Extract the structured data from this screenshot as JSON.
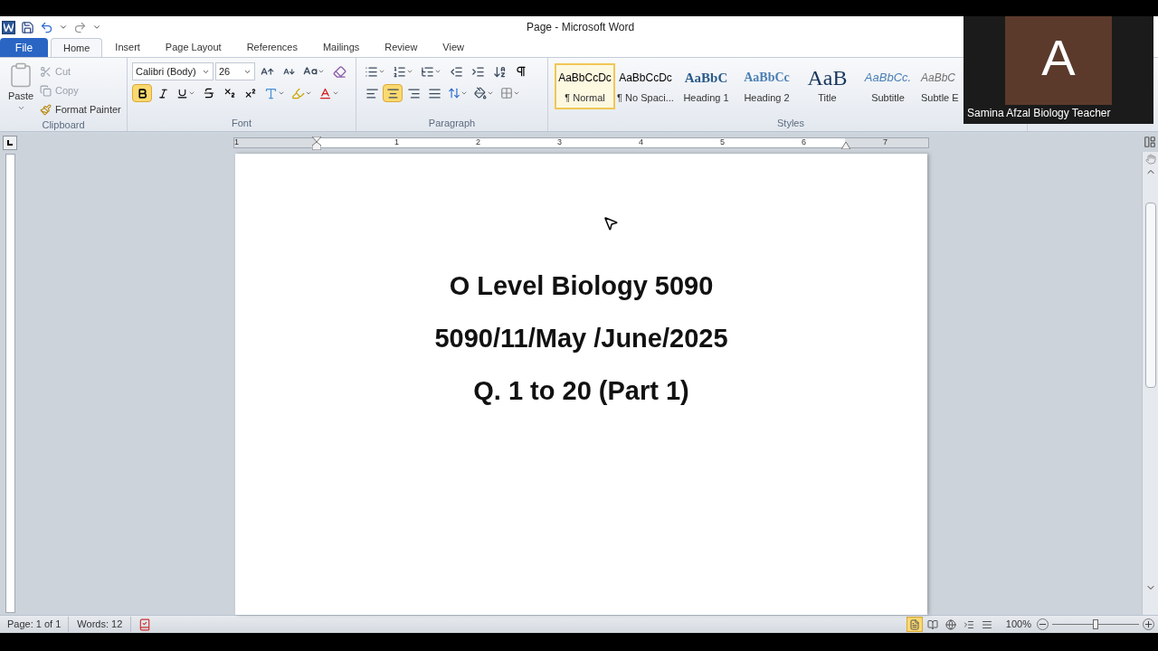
{
  "title_bar": {
    "title": "Page - Microsoft Word"
  },
  "tabs": [
    {
      "label": "File",
      "selected": false,
      "kind": "file"
    },
    {
      "label": "Home",
      "selected": true,
      "kind": "tab"
    },
    {
      "label": "Insert",
      "selected": false,
      "kind": "tab"
    },
    {
      "label": "Page Layout",
      "selected": false,
      "kind": "tab"
    },
    {
      "label": "References",
      "selected": false,
      "kind": "tab"
    },
    {
      "label": "Mailings",
      "selected": false,
      "kind": "tab"
    },
    {
      "label": "Review",
      "selected": false,
      "kind": "tab"
    },
    {
      "label": "View",
      "selected": false,
      "kind": "tab"
    }
  ],
  "clipboard": {
    "paste": "Paste",
    "cut": "Cut",
    "copy": "Copy",
    "format_painter": "Format Painter",
    "group": "Clipboard"
  },
  "font": {
    "name": "Calibri (Body)",
    "size": "26",
    "bold": true,
    "italic": false,
    "underline": false,
    "group": "Font"
  },
  "paragraph": {
    "show_marks": false,
    "group": "Paragraph",
    "alignments": [
      {
        "kind": "left",
        "selected": false
      },
      {
        "kind": "center",
        "selected": true
      },
      {
        "kind": "right",
        "selected": false
      },
      {
        "kind": "justify",
        "selected": false
      }
    ]
  },
  "styles": {
    "group": "Styles",
    "items": [
      {
        "preview": "AaBbCcDc",
        "label": "¶ Normal",
        "selected": true,
        "kind": "normal"
      },
      {
        "preview": "AaBbCcDc",
        "label": "¶ No Spaci...",
        "selected": false,
        "kind": "normal"
      },
      {
        "preview": "AaBbC",
        "label": "Heading 1",
        "selected": false,
        "kind": "heading1"
      },
      {
        "preview": "AaBbCc",
        "label": "Heading 2",
        "selected": false,
        "kind": "heading2"
      },
      {
        "preview": "AaB",
        "label": "Title",
        "selected": false,
        "kind": "title"
      },
      {
        "preview": "AaBbCc.",
        "label": "Subtitle",
        "selected": false,
        "kind": "subtitle"
      },
      {
        "preview": "AaBbC",
        "label": "Subtle E",
        "selected": false,
        "kind": "subtle"
      }
    ]
  },
  "video": {
    "initial": "A",
    "name": "Samina Afzal Biology Teacher"
  },
  "ruler": {
    "left_mark": "1",
    "marks": [
      "1",
      "2",
      "3",
      "4",
      "5",
      "6",
      "7"
    ]
  },
  "document": {
    "lines": [
      "O Level Biology 5090",
      "5090/11/May /June/2025",
      "Q. 1 to 20 (Part 1)"
    ]
  },
  "status_bar": {
    "page": "Page: 1 of 1",
    "words": "Words: 12",
    "zoom": "100%",
    "zoom_slider": {
      "level": 0.5
    },
    "views": [
      {
        "kind": "print",
        "selected": true
      },
      {
        "kind": "reading",
        "selected": false
      },
      {
        "kind": "web",
        "selected": false
      },
      {
        "kind": "outline",
        "selected": false
      },
      {
        "kind": "draft",
        "selected": false
      }
    ]
  }
}
